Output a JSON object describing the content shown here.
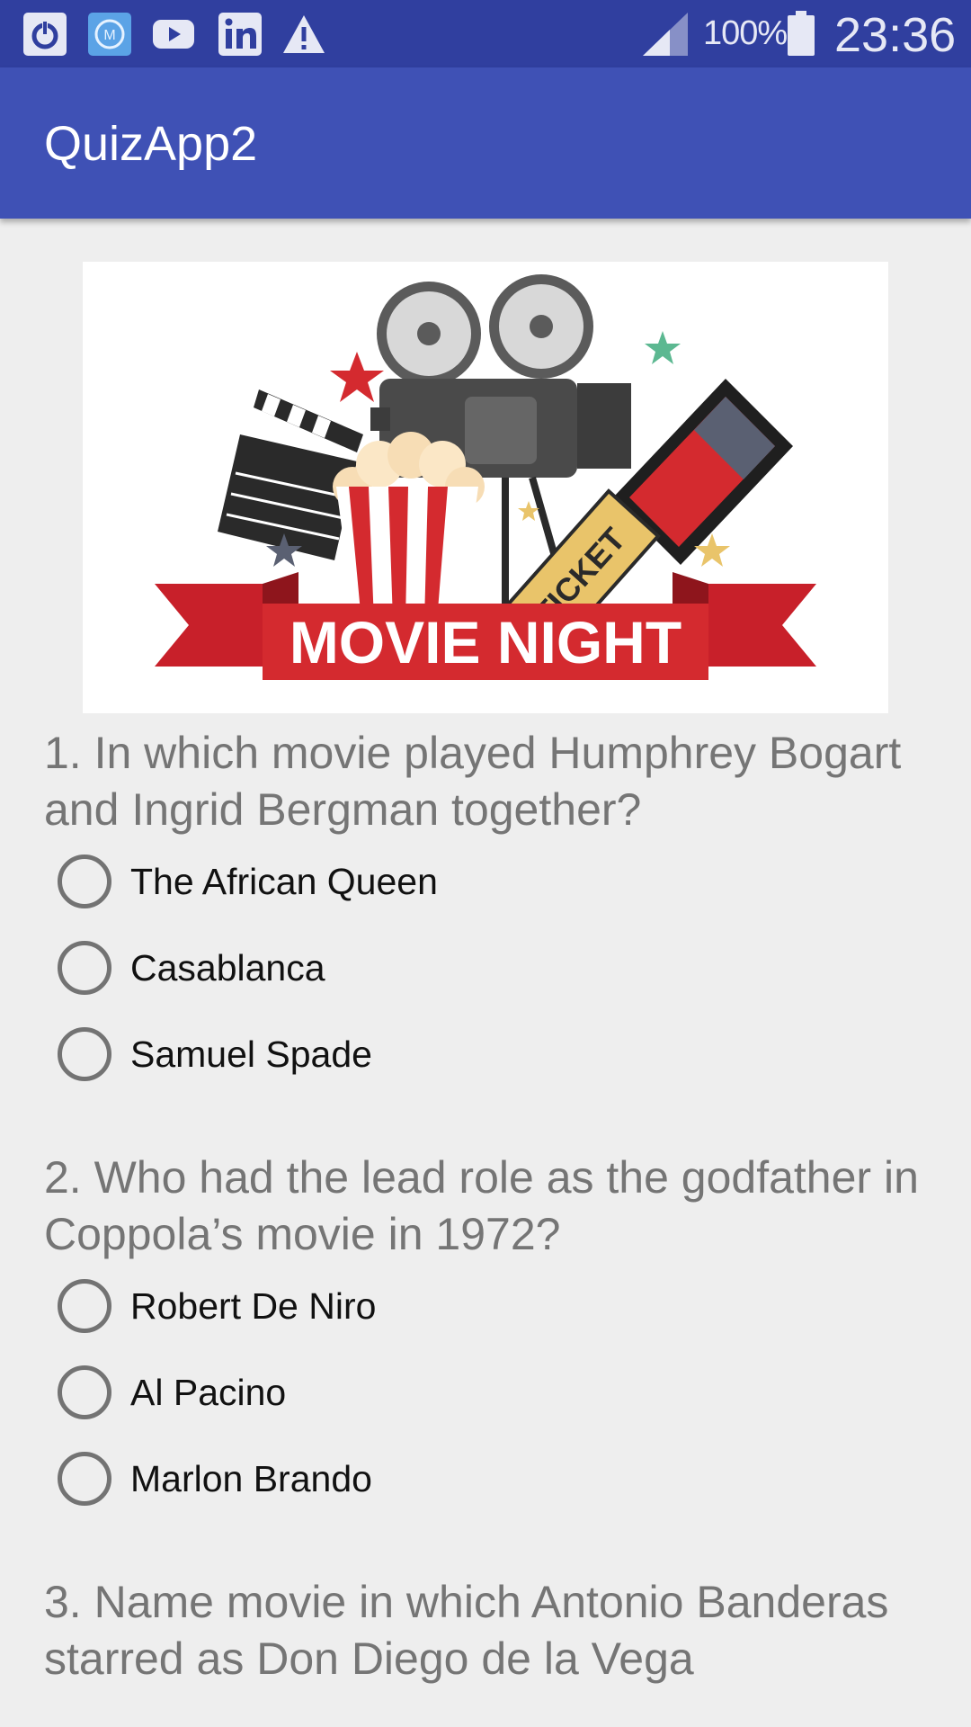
{
  "status_bar": {
    "notification_icons": [
      "power-icon",
      "mailbox-icon",
      "youtube-icon",
      "linkedin-icon",
      "warning-icon"
    ],
    "signal_icon": "signal-icon",
    "battery_percent": "100%",
    "battery_icon": "battery-icon",
    "clock": "23:36"
  },
  "app_bar": {
    "title": "QuizApp2"
  },
  "hero_image": {
    "banner_text": "MOVIE NIGHT",
    "ticket_text": "TICKET"
  },
  "questions": [
    {
      "text": "1. In which movie played Humphrey Bogart and Ingrid Bergman together?",
      "options": [
        "The African Queen",
        "Casablanca",
        "Samuel Spade"
      ]
    },
    {
      "text": "2. Who had the lead role as the godfather in Coppola’s movie in 1972?",
      "options": [
        "Robert De Niro",
        "Al Pacino",
        "Marlon Brando"
      ]
    },
    {
      "text": "3. Name movie in which Antonio Banderas starred as Don Diego de la Vega",
      "options": []
    }
  ],
  "colors": {
    "status_bar": "#303f9f",
    "app_bar": "#3f51b5",
    "background": "#eeeeee",
    "question_text": "#757575",
    "radio_outline": "#737373"
  }
}
